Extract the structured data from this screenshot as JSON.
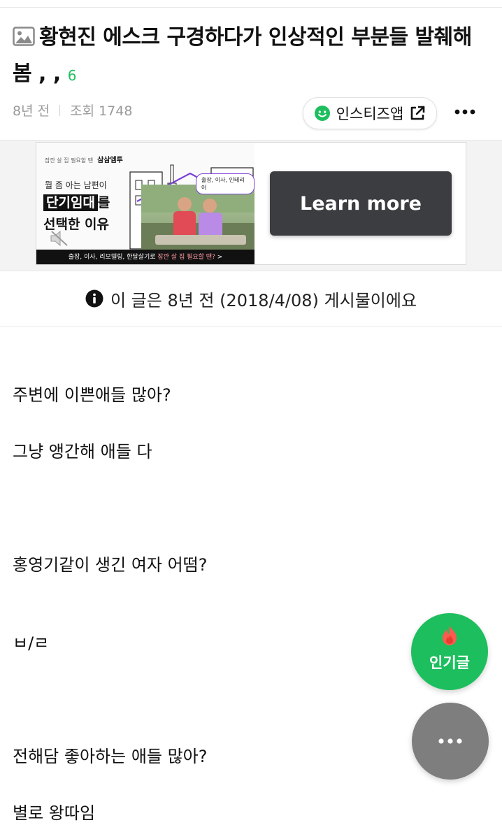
{
  "post": {
    "title": "황현진 에스크 구경하다가 인상적인 부분들 발췌해 봄 , ,",
    "comment_count": "6",
    "time_ago": "8년 전",
    "views": "조회 1748"
  },
  "header": {
    "app_button_label": "인스티즈앱",
    "app_button_icons": [
      "smile-icon",
      "external-link-icon"
    ],
    "more_icon": "more-horizontal-icon"
  },
  "ad": {
    "brand_tagline": "잠깐 살 집 필요할 땐",
    "brand_name": "삼삼엠투",
    "subline": "뭘 좀 아는 남편이",
    "headline_box": "단기임대",
    "headline_suffix": "를",
    "headline_line2": "선택한 이유",
    "video_pill": "출장, 이사, 인테리어",
    "bottom_bar_prefix": "출장, 이사, 리모델링, 한달살기로 ",
    "bottom_bar_highlight": "잠깐 살 집 필요할 땐?",
    "bottom_bar_suffix": " >",
    "cta_label": "Learn more",
    "mute_icon": "mute-icon"
  },
  "notice": {
    "text": "이 글은 8년 전 (2018/4/08) 게시물이에요",
    "icon": "info-icon"
  },
  "content": {
    "lines": [
      "주변에 이쁜애들 많아?",
      "그냥 앵간해 애들 다",
      "홍영기같이 생긴 여자 어떰?",
      "ㅂ/ㄹ",
      "전해담 좋아하는 애들 많아?",
      "별로 왕따임"
    ]
  },
  "fab": {
    "hot_label": "인기글",
    "hot_icon": "flame-icon",
    "more_icon": "more-dots-icon"
  },
  "colors": {
    "accent_green": "#1dbe5e",
    "cta_dark": "#3c3d40",
    "fab_gray": "#7e7e7e"
  }
}
